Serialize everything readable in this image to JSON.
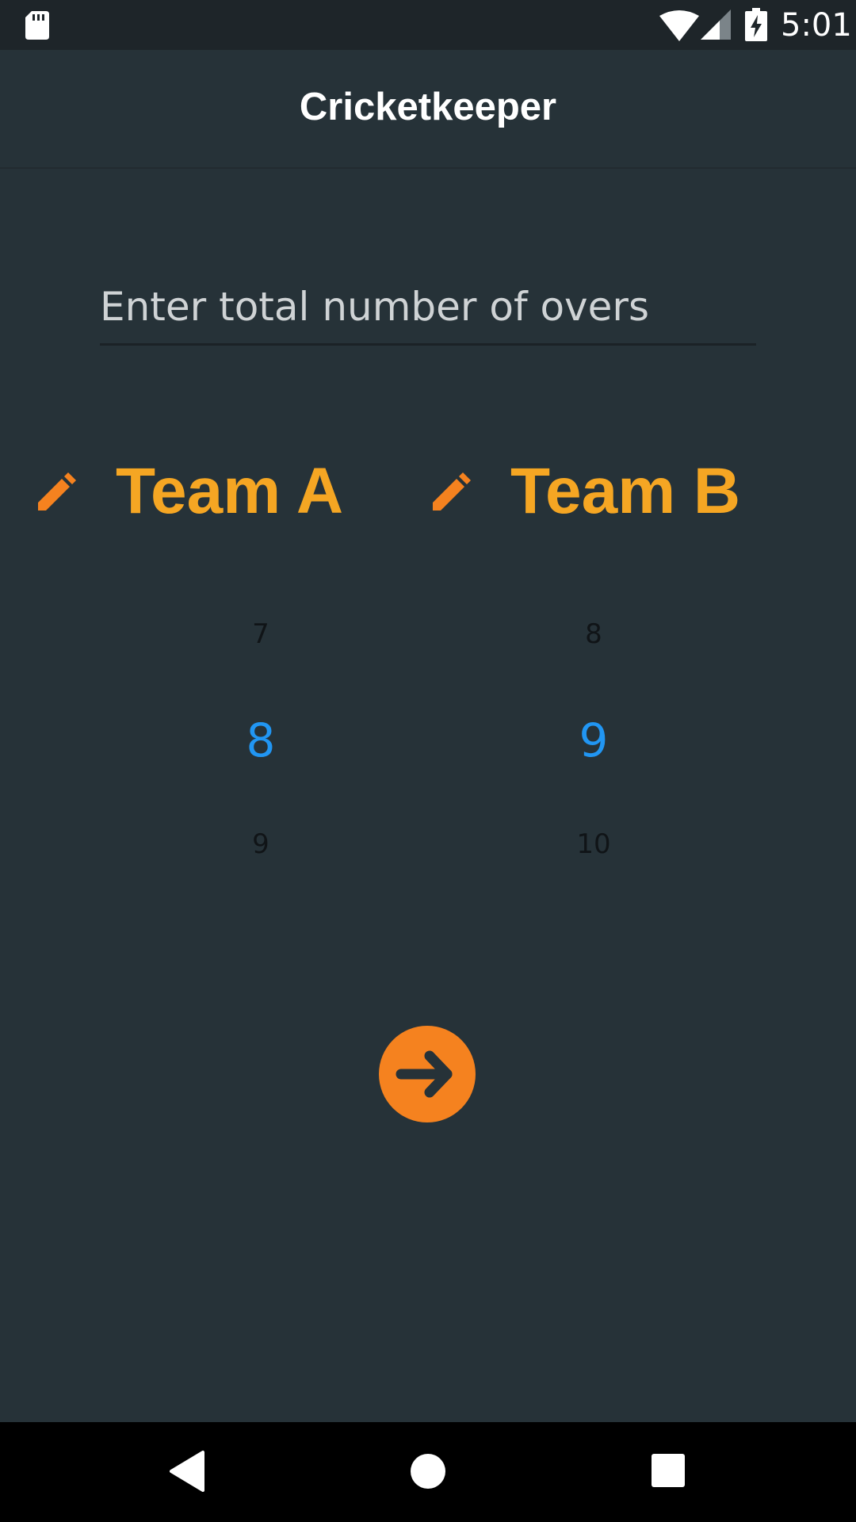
{
  "status_bar": {
    "time": "5:01",
    "icons": [
      "sd-card-icon",
      "wifi-icon",
      "signal-icon",
      "battery-charging-icon"
    ]
  },
  "app": {
    "title": "Cricketkeeper"
  },
  "overs_input": {
    "placeholder": "Enter total number of overs",
    "value": ""
  },
  "teams": [
    {
      "name": "Team A",
      "edit_icon": "pencil-icon"
    },
    {
      "name": "Team B",
      "edit_icon": "pencil-icon"
    }
  ],
  "pickers": [
    {
      "prev": "7",
      "selected": "8",
      "next": "9"
    },
    {
      "prev": "8",
      "selected": "9",
      "next": "10"
    }
  ],
  "fab": {
    "icon": "arrow-right-icon"
  },
  "nav_bar": {
    "icons": [
      "back-icon",
      "home-icon",
      "recents-icon"
    ]
  },
  "colors": {
    "background": "#263238",
    "accent": "#f5a623",
    "fab": "#f5821f",
    "picker_selected": "#2196f3"
  }
}
